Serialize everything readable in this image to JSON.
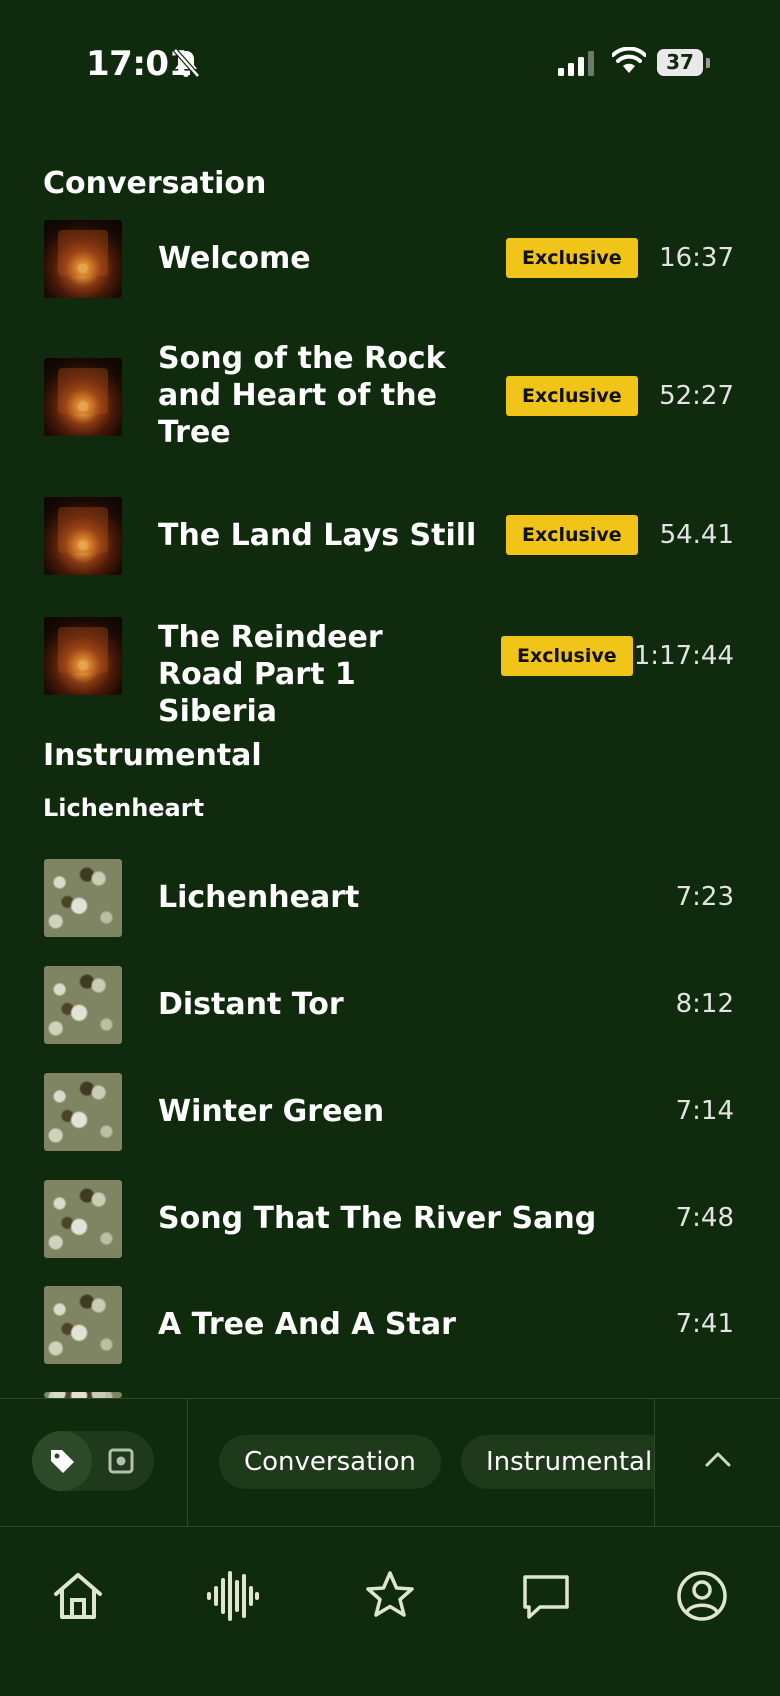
{
  "status": {
    "time": "17:01",
    "battery": "37"
  },
  "sections": {
    "conversation": "Conversation",
    "instrumental": "Instrumental",
    "instrumental_sub": "Lichenheart"
  },
  "conversation_tracks": [
    {
      "title": "Welcome",
      "badge": "Exclusive",
      "duration": "16:37"
    },
    {
      "title": "Song of the Rock and Heart of the Tree",
      "badge": "Exclusive",
      "duration": "52:27"
    },
    {
      "title": "The Land Lays Still",
      "badge": "Exclusive",
      "duration": "54.41"
    },
    {
      "title": "The Reindeer Road Part 1 Siberia",
      "badge": "Exclusive",
      "duration": "1:17:44"
    }
  ],
  "instrumental_tracks": [
    {
      "title": "Lichenheart",
      "duration": "7:23"
    },
    {
      "title": "Distant Tor",
      "duration": "8:12"
    },
    {
      "title": "Winter Green",
      "duration": "7:14"
    },
    {
      "title": "Song That The River Sang",
      "duration": "7:48"
    },
    {
      "title": "A Tree And A Star",
      "duration": "7:41"
    }
  ],
  "filter_chips": [
    "Conversation",
    "Instrumental"
  ],
  "tabs": [
    "home-icon",
    "waveform-icon",
    "star-icon",
    "chat-icon",
    "profile-icon"
  ],
  "colors": {
    "background": "#0f2a0c",
    "badge": "#f0c419",
    "chip": "#1f3a1b",
    "icon": "#dfe6cf"
  }
}
